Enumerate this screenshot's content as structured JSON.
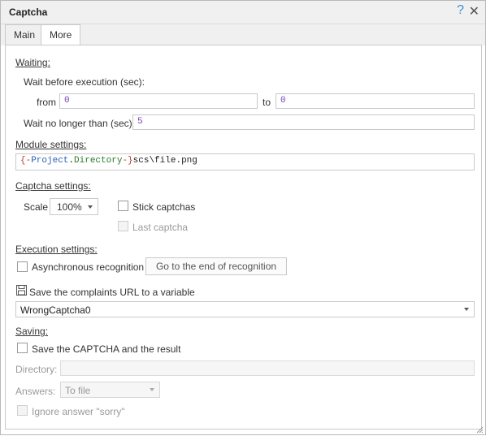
{
  "window": {
    "title": "Captcha",
    "help_icon": "question-icon",
    "close_icon": "close-icon"
  },
  "tabs": [
    {
      "label": "Main"
    },
    {
      "label": "More"
    }
  ],
  "waiting": {
    "header": "Waiting:",
    "wait_before_label": "Wait before execution (sec):",
    "from_label": "from",
    "from_value": "0",
    "to_label": "to",
    "to_value": "0",
    "wait_no_longer_label": "Wait no longer than (sec):",
    "wait_no_longer_value": "5"
  },
  "module": {
    "header": "Module settings:",
    "path_tokens": {
      "open": "{-",
      "project": "Project",
      "dot1": ".",
      "directory": "Directory",
      "close": "-}",
      "rest": "scs\\file.png"
    }
  },
  "captcha": {
    "header": "Captcha settings:",
    "scale_label": "Scale",
    "scale_value": "100%",
    "stick_label": "Stick captchas",
    "last_label": "Last captcha"
  },
  "execution": {
    "header": "Execution settings:",
    "async_label": "Asynchronous recognition",
    "goto_button": "Go to the end of recognition",
    "save_complaints_label": "Save the complaints URL to a variable",
    "variable_value": "WrongCaptcha0"
  },
  "saving": {
    "header": "Saving:",
    "save_label": "Save the CAPTCHA and the result",
    "directory_label": "Directory:",
    "directory_value": "",
    "answers_label": "Answers:",
    "answers_value": "To file",
    "ignore_label": "Ignore answer \"sorry\""
  },
  "colors": {
    "accent": "#3b8fd6",
    "number": "#7a3db8",
    "brace": "#c0392b",
    "project": "#2b5fb3"
  }
}
